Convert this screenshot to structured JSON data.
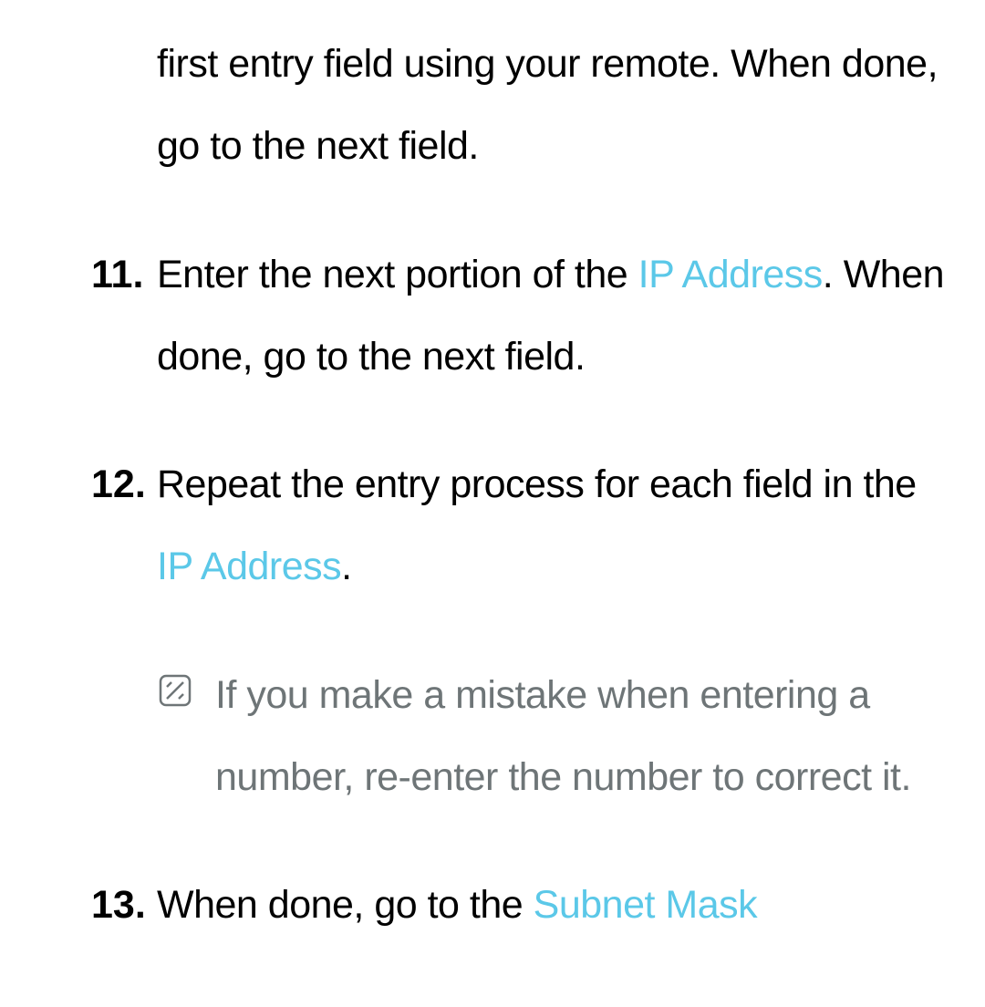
{
  "steps": {
    "s0": {
      "text": "first entry field using your remote. When done, go to the next field."
    },
    "s11": {
      "number": "11.",
      "pre": "Enter the next portion of the ",
      "hl": "IP Address",
      "post": ". When done, go to the next field."
    },
    "s12": {
      "number": "12.",
      "pre": "Repeat the entry process for each field in the ",
      "hl": "IP Address",
      "post": "."
    },
    "note": {
      "text": "If you make a mistake when entering a number, re-enter the number to correct it."
    },
    "s13": {
      "number": "13.",
      "pre": "When done, go to the ",
      "hl": "Subnet Mask"
    }
  }
}
